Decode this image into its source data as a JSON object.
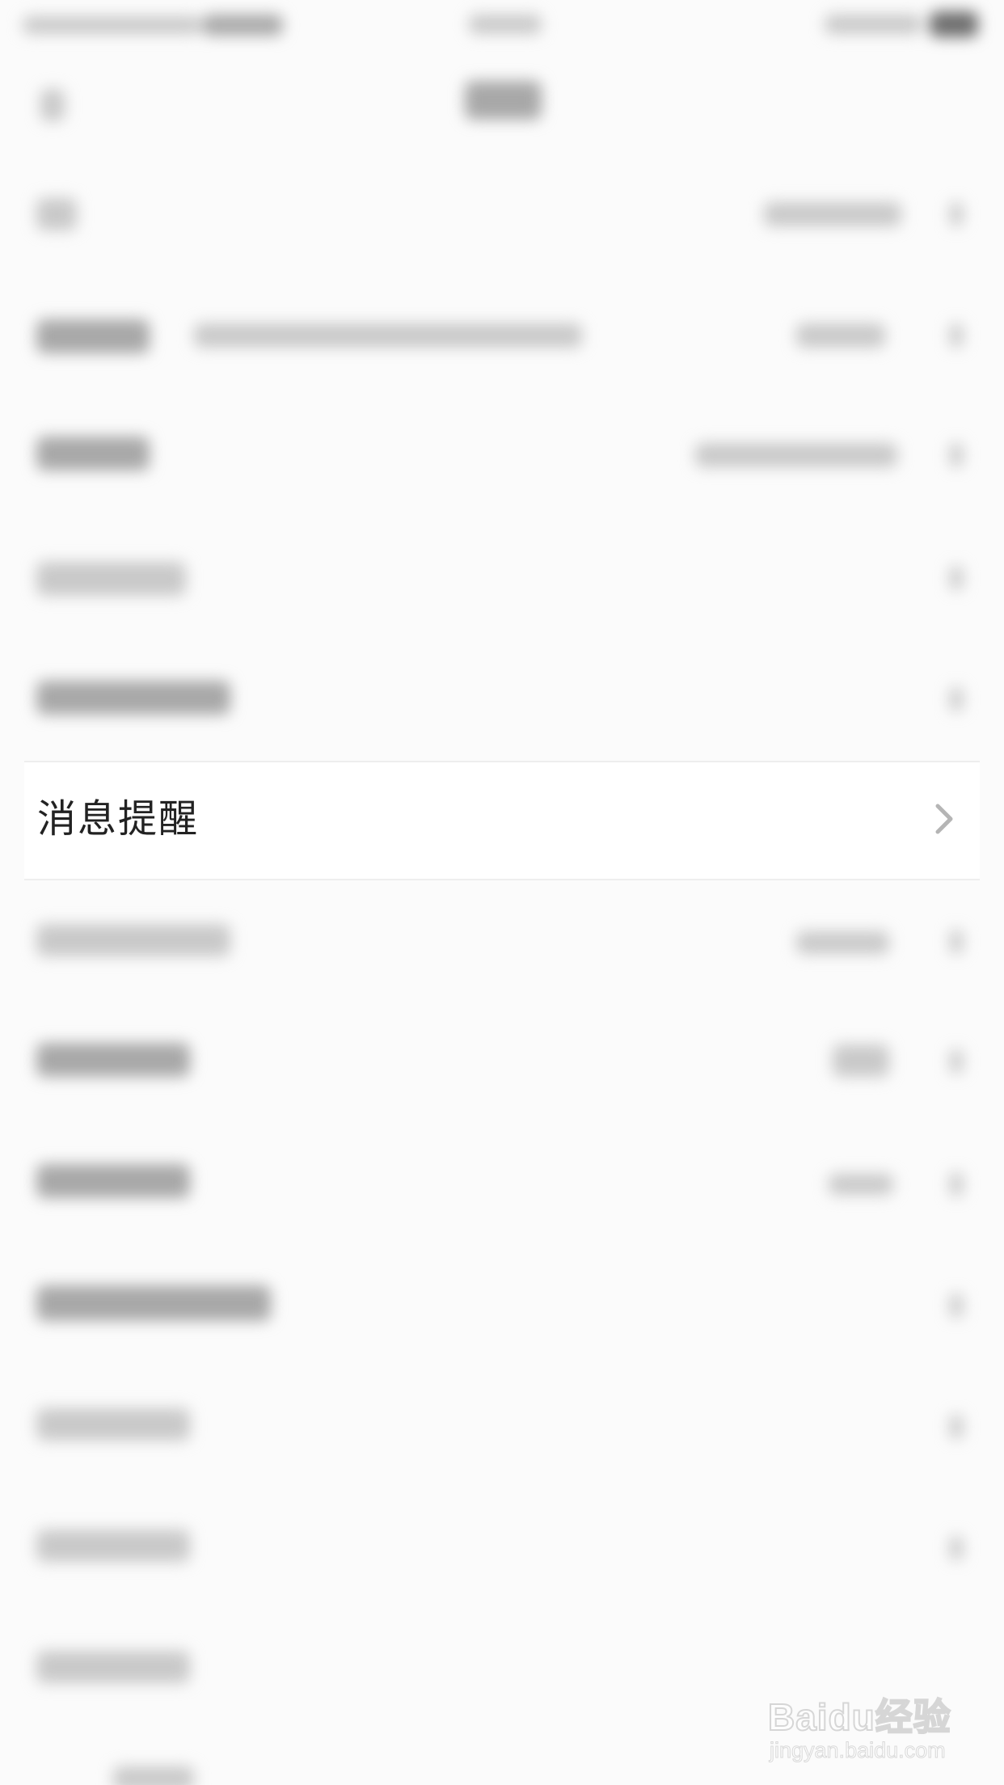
{
  "settings_list": {
    "highlighted_item": {
      "label": "消息提醒",
      "icon": "chevron-right-icon"
    }
  },
  "watermark": {
    "brand": "Baidu经验",
    "url": "jingyan.baidu.com"
  },
  "colors": {
    "background": "#fbfbfb",
    "row_background": "#ffffff",
    "label_text": "#222222",
    "chevron": "#b5b5b5"
  }
}
